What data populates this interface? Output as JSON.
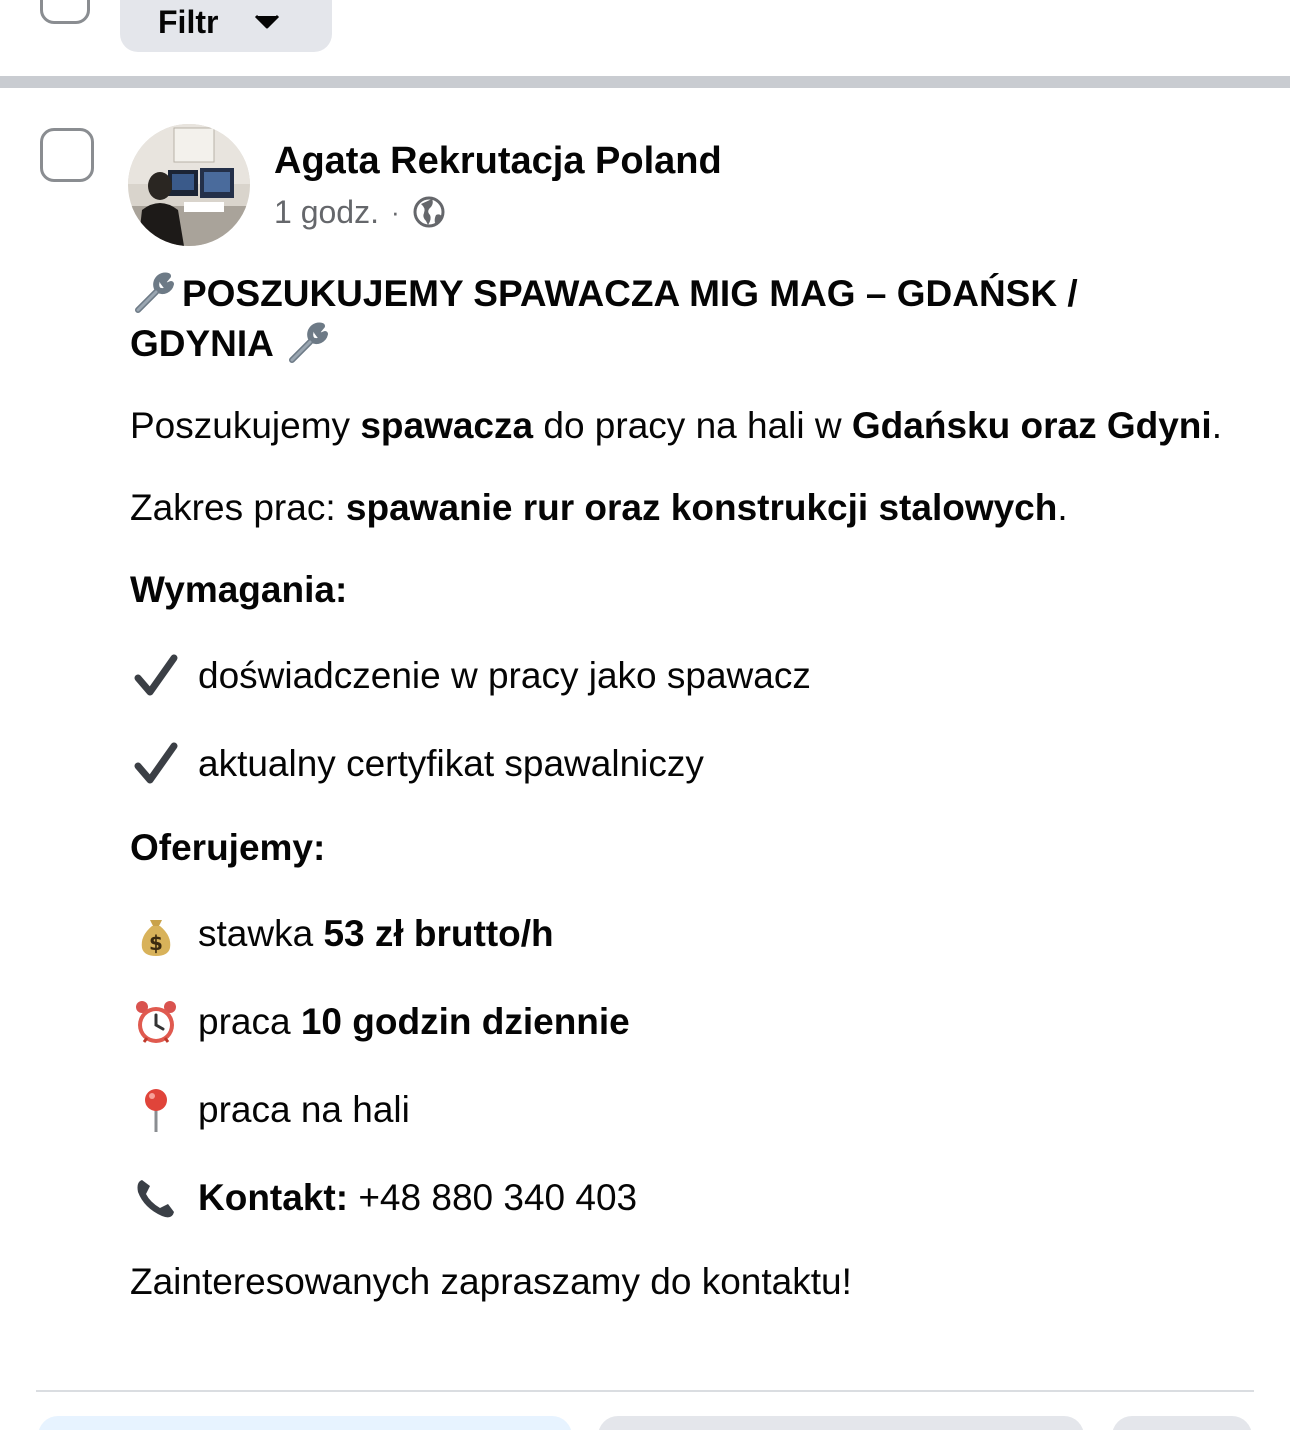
{
  "toolbar": {
    "filter_label": "Filtr"
  },
  "post": {
    "author": "Agata Rekrutacja Poland",
    "time": "1 godz.",
    "separator": "·",
    "headline": "POSZUKUJEMY SPAWACZA MIG MAG – GDAŃSK / GDYNIA",
    "intro": {
      "pre": "Poszukujemy ",
      "b1": "spawacza",
      "mid": " do pracy na hali w ",
      "b2": "Gdańsku oraz Gdyni",
      "post": "."
    },
    "scope": {
      "pre": "Zakres prac: ",
      "bold": "spawanie rur oraz konstrukcji stalowych",
      "post": "."
    },
    "requirements_title": "Wymagania:",
    "requirements": [
      {
        "icon": "check-icon",
        "text": "doświadczenie w pracy jako spawacz"
      },
      {
        "icon": "check-icon",
        "text": "aktualny certyfikat spawalniczy"
      }
    ],
    "offer_title": "Oferujemy:",
    "offer": {
      "rate_pre": "stawka ",
      "rate_bold": "53 zł brutto/h",
      "hours_pre": "praca ",
      "hours_bold": "10 godzin dziennie",
      "place": "praca na hali"
    },
    "contact": {
      "label": "Kontakt:",
      "phone": " +48 880 340 403"
    },
    "closing": "Zainteresowanych zapraszamy do kontaktu!"
  },
  "icons": {
    "headline": "wrench-icon",
    "rate": "money-bag-icon",
    "hours": "alarm-clock-icon",
    "place": "pin-icon",
    "contact": "phone-icon"
  }
}
